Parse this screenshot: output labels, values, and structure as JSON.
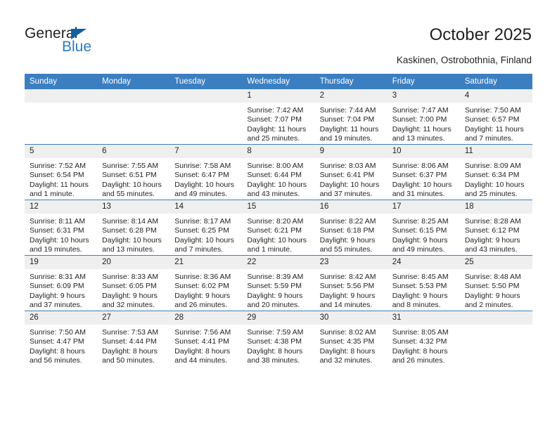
{
  "brand": {
    "name_top": "General",
    "name_bottom": "Blue"
  },
  "header": {
    "title": "October 2025",
    "subtitle": "Kaskinen, Ostrobothnia, Finland"
  },
  "calendar": {
    "weekday_headers": [
      "Sunday",
      "Monday",
      "Tuesday",
      "Wednesday",
      "Thursday",
      "Friday",
      "Saturday"
    ],
    "colors": {
      "header_blue": "#3c7fc1",
      "daynum_band": "#efefef",
      "brand_blue": "#2b7bc4",
      "logo_triangle": "#1060a8",
      "text": "#231f20"
    },
    "weeks": [
      [
        {
          "day": "",
          "blank": true
        },
        {
          "day": "",
          "blank": true
        },
        {
          "day": "",
          "blank": true
        },
        {
          "day": "1",
          "sunrise": "Sunrise: 7:42 AM",
          "sunset": "Sunset: 7:07 PM",
          "daylight1": "Daylight: 11 hours",
          "daylight2": "and 25 minutes."
        },
        {
          "day": "2",
          "sunrise": "Sunrise: 7:44 AM",
          "sunset": "Sunset: 7:04 PM",
          "daylight1": "Daylight: 11 hours",
          "daylight2": "and 19 minutes."
        },
        {
          "day": "3",
          "sunrise": "Sunrise: 7:47 AM",
          "sunset": "Sunset: 7:00 PM",
          "daylight1": "Daylight: 11 hours",
          "daylight2": "and 13 minutes."
        },
        {
          "day": "4",
          "sunrise": "Sunrise: 7:50 AM",
          "sunset": "Sunset: 6:57 PM",
          "daylight1": "Daylight: 11 hours",
          "daylight2": "and 7 minutes."
        }
      ],
      [
        {
          "day": "5",
          "sunrise": "Sunrise: 7:52 AM",
          "sunset": "Sunset: 6:54 PM",
          "daylight1": "Daylight: 11 hours",
          "daylight2": "and 1 minute."
        },
        {
          "day": "6",
          "sunrise": "Sunrise: 7:55 AM",
          "sunset": "Sunset: 6:51 PM",
          "daylight1": "Daylight: 10 hours",
          "daylight2": "and 55 minutes."
        },
        {
          "day": "7",
          "sunrise": "Sunrise: 7:58 AM",
          "sunset": "Sunset: 6:47 PM",
          "daylight1": "Daylight: 10 hours",
          "daylight2": "and 49 minutes."
        },
        {
          "day": "8",
          "sunrise": "Sunrise: 8:00 AM",
          "sunset": "Sunset: 6:44 PM",
          "daylight1": "Daylight: 10 hours",
          "daylight2": "and 43 minutes."
        },
        {
          "day": "9",
          "sunrise": "Sunrise: 8:03 AM",
          "sunset": "Sunset: 6:41 PM",
          "daylight1": "Daylight: 10 hours",
          "daylight2": "and 37 minutes."
        },
        {
          "day": "10",
          "sunrise": "Sunrise: 8:06 AM",
          "sunset": "Sunset: 6:37 PM",
          "daylight1": "Daylight: 10 hours",
          "daylight2": "and 31 minutes."
        },
        {
          "day": "11",
          "sunrise": "Sunrise: 8:09 AM",
          "sunset": "Sunset: 6:34 PM",
          "daylight1": "Daylight: 10 hours",
          "daylight2": "and 25 minutes."
        }
      ],
      [
        {
          "day": "12",
          "sunrise": "Sunrise: 8:11 AM",
          "sunset": "Sunset: 6:31 PM",
          "daylight1": "Daylight: 10 hours",
          "daylight2": "and 19 minutes."
        },
        {
          "day": "13",
          "sunrise": "Sunrise: 8:14 AM",
          "sunset": "Sunset: 6:28 PM",
          "daylight1": "Daylight: 10 hours",
          "daylight2": "and 13 minutes."
        },
        {
          "day": "14",
          "sunrise": "Sunrise: 8:17 AM",
          "sunset": "Sunset: 6:25 PM",
          "daylight1": "Daylight: 10 hours",
          "daylight2": "and 7 minutes."
        },
        {
          "day": "15",
          "sunrise": "Sunrise: 8:20 AM",
          "sunset": "Sunset: 6:21 PM",
          "daylight1": "Daylight: 10 hours",
          "daylight2": "and 1 minute."
        },
        {
          "day": "16",
          "sunrise": "Sunrise: 8:22 AM",
          "sunset": "Sunset: 6:18 PM",
          "daylight1": "Daylight: 9 hours",
          "daylight2": "and 55 minutes."
        },
        {
          "day": "17",
          "sunrise": "Sunrise: 8:25 AM",
          "sunset": "Sunset: 6:15 PM",
          "daylight1": "Daylight: 9 hours",
          "daylight2": "and 49 minutes."
        },
        {
          "day": "18",
          "sunrise": "Sunrise: 8:28 AM",
          "sunset": "Sunset: 6:12 PM",
          "daylight1": "Daylight: 9 hours",
          "daylight2": "and 43 minutes."
        }
      ],
      [
        {
          "day": "19",
          "sunrise": "Sunrise: 8:31 AM",
          "sunset": "Sunset: 6:09 PM",
          "daylight1": "Daylight: 9 hours",
          "daylight2": "and 37 minutes."
        },
        {
          "day": "20",
          "sunrise": "Sunrise: 8:33 AM",
          "sunset": "Sunset: 6:05 PM",
          "daylight1": "Daylight: 9 hours",
          "daylight2": "and 32 minutes."
        },
        {
          "day": "21",
          "sunrise": "Sunrise: 8:36 AM",
          "sunset": "Sunset: 6:02 PM",
          "daylight1": "Daylight: 9 hours",
          "daylight2": "and 26 minutes."
        },
        {
          "day": "22",
          "sunrise": "Sunrise: 8:39 AM",
          "sunset": "Sunset: 5:59 PM",
          "daylight1": "Daylight: 9 hours",
          "daylight2": "and 20 minutes."
        },
        {
          "day": "23",
          "sunrise": "Sunrise: 8:42 AM",
          "sunset": "Sunset: 5:56 PM",
          "daylight1": "Daylight: 9 hours",
          "daylight2": "and 14 minutes."
        },
        {
          "day": "24",
          "sunrise": "Sunrise: 8:45 AM",
          "sunset": "Sunset: 5:53 PM",
          "daylight1": "Daylight: 9 hours",
          "daylight2": "and 8 minutes."
        },
        {
          "day": "25",
          "sunrise": "Sunrise: 8:48 AM",
          "sunset": "Sunset: 5:50 PM",
          "daylight1": "Daylight: 9 hours",
          "daylight2": "and 2 minutes."
        }
      ],
      [
        {
          "day": "26",
          "sunrise": "Sunrise: 7:50 AM",
          "sunset": "Sunset: 4:47 PM",
          "daylight1": "Daylight: 8 hours",
          "daylight2": "and 56 minutes."
        },
        {
          "day": "27",
          "sunrise": "Sunrise: 7:53 AM",
          "sunset": "Sunset: 4:44 PM",
          "daylight1": "Daylight: 8 hours",
          "daylight2": "and 50 minutes."
        },
        {
          "day": "28",
          "sunrise": "Sunrise: 7:56 AM",
          "sunset": "Sunset: 4:41 PM",
          "daylight1": "Daylight: 8 hours",
          "daylight2": "and 44 minutes."
        },
        {
          "day": "29",
          "sunrise": "Sunrise: 7:59 AM",
          "sunset": "Sunset: 4:38 PM",
          "daylight1": "Daylight: 8 hours",
          "daylight2": "and 38 minutes."
        },
        {
          "day": "30",
          "sunrise": "Sunrise: 8:02 AM",
          "sunset": "Sunset: 4:35 PM",
          "daylight1": "Daylight: 8 hours",
          "daylight2": "and 32 minutes."
        },
        {
          "day": "31",
          "sunrise": "Sunrise: 8:05 AM",
          "sunset": "Sunset: 4:32 PM",
          "daylight1": "Daylight: 8 hours",
          "daylight2": "and 26 minutes."
        },
        {
          "day": "",
          "blank": true
        }
      ]
    ]
  }
}
